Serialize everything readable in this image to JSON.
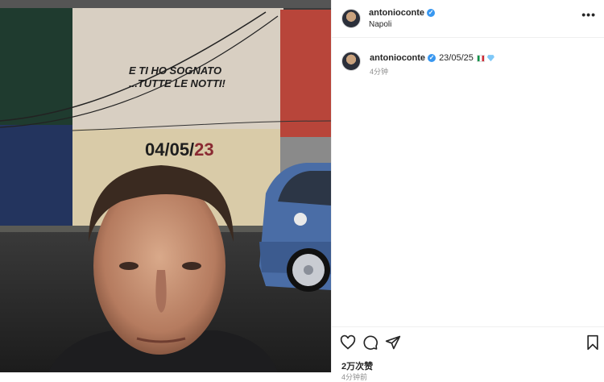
{
  "photo": {
    "wall_text_line1": "E TI HO SOGNATO",
    "wall_text_line2": "...TUTTE LE NOTTI!",
    "date_white": "04/05/",
    "date_red": "23"
  },
  "header": {
    "username": "antonioconte",
    "location": "Napoli",
    "more_label": "•••"
  },
  "caption": {
    "username": "antonioconte",
    "text": "23/05/25",
    "time": "4分钟"
  },
  "footer": {
    "likes": "2万次赞",
    "posted": "4分钟前"
  },
  "icons": [
    "heart-icon",
    "comment-icon",
    "share-icon",
    "bookmark-icon",
    "verified-icon",
    "italy-flag-icon",
    "diamond-icon"
  ]
}
